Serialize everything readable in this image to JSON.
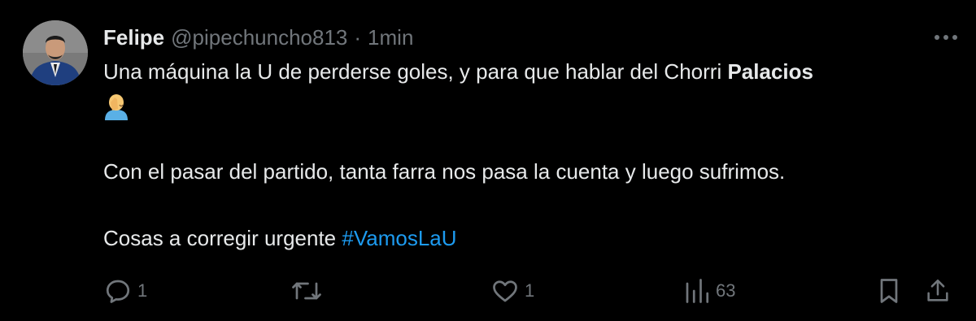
{
  "tweet": {
    "display_name": "Felipe",
    "handle": "@pipechuncho813",
    "separator": "·",
    "time": "1min",
    "text": {
      "line1_prefix": "Una máquina la U de perderse goles, y para que hablar del Chorri ",
      "line1_bold": "Palacios",
      "emoji_name": "man-facepalming-emoji",
      "paragraph2": "Con el pasar del partido, tanta farra nos pasa la cuenta y luego sufrimos.",
      "paragraph3_prefix": "Cosas a corregir urgente ",
      "hashtag": "#VamosLaU"
    }
  },
  "actions": {
    "replies": "1",
    "retweets": "",
    "likes": "1",
    "views": "63"
  },
  "colors": {
    "background": "#000000",
    "text": "#e7e9ea",
    "muted": "#71767b",
    "link": "#1d9bf0"
  },
  "icons": [
    "reply-icon",
    "retweet-icon",
    "like-icon",
    "views-icon",
    "bookmark-icon",
    "share-icon",
    "more-icon"
  ]
}
